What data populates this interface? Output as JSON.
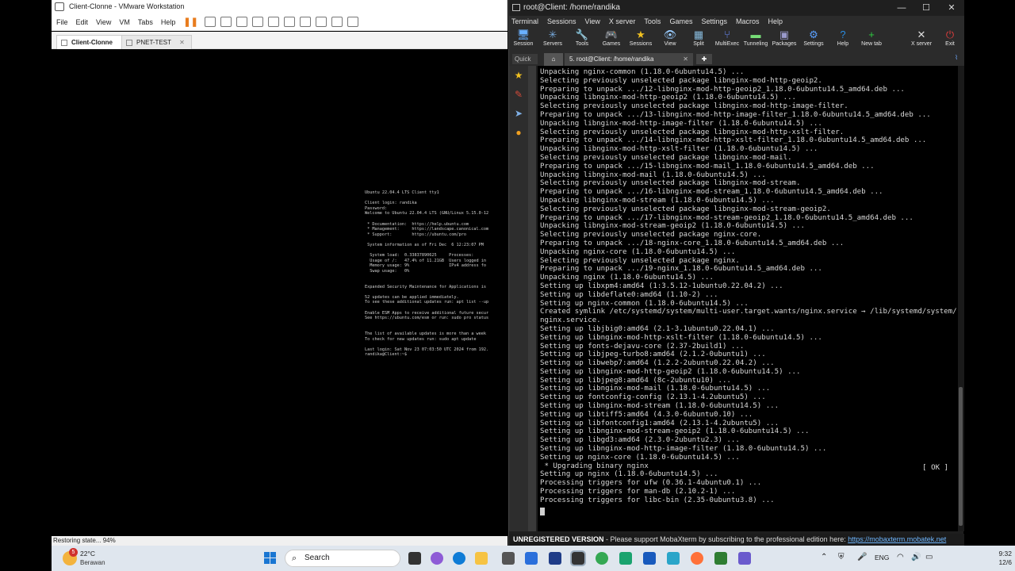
{
  "vmware": {
    "title": "Client-Clonne - VMware Workstation",
    "menu": [
      "File",
      "Edit",
      "View",
      "VM",
      "Tabs",
      "Help"
    ],
    "tabs": [
      {
        "label": "Client-Clonne",
        "active": true
      },
      {
        "label": "PNET-TEST",
        "active": false
      }
    ],
    "console_text": "Ubuntu 22.04.4 LTS Client tty1\n\nClient login: randika\nPassword:\nWelcome to Ubuntu 22.04.4 LTS (GNU/Linux 5.15.0-12\n\n * Documentation:  https://help.ubuntu.com\n * Management:     https://landscape.canonical.com\n * Support:        https://ubuntu.com/pro\n\n System information as of Fri Dec  6 12:23:07 PM\n\n  System load:  0.33837890625     Processes:\n  Usage of /:   47.4% of 11.21GB  Users logged in\n  Memory usage: 9%                IPv4 address fo\n  Swap usage:   0%\n\n\nExpanded Security Maintenance for Applications is\n\n52 updates can be applied immediately.\nTo see these additional updates run: apt list --up\n\nEnable ESM Apps to receive additional future secur\nSee https://ubuntu.com/esm or run: sudo pro status\n\n\nThe list of available updates is more than a week\nTo check for new updates run: sudo apt update\n\nLast login: Sat Nov 23 07:03:50 UTC 2024 from 192.\nrandika@Client:~$",
    "status": "Restoring state... 94%"
  },
  "moba": {
    "title": "root@Client: /home/randika",
    "menu": [
      "Terminal",
      "Sessions",
      "View",
      "X server",
      "Tools",
      "Games",
      "Settings",
      "Macros",
      "Help"
    ],
    "toolbar": [
      {
        "label": "Session",
        "icon": "session-icon",
        "glyph": "🖥"
      },
      {
        "label": "Servers",
        "icon": "servers-icon",
        "glyph": "✳"
      },
      {
        "label": "Tools",
        "icon": "tools-icon",
        "glyph": "🔧"
      },
      {
        "label": "Games",
        "icon": "games-icon",
        "glyph": "🎮"
      },
      {
        "label": "Sessions",
        "icon": "sessions-icon",
        "glyph": "★"
      },
      {
        "label": "View",
        "icon": "view-icon",
        "glyph": "👁"
      },
      {
        "label": "Split",
        "icon": "split-icon",
        "glyph": "▦"
      },
      {
        "label": "MultiExec",
        "icon": "multiexec-icon",
        "glyph": "⑂"
      },
      {
        "label": "Tunneling",
        "icon": "tunneling-icon",
        "glyph": "▬"
      },
      {
        "label": "Packages",
        "icon": "packages-icon",
        "glyph": "▣"
      },
      {
        "label": "Settings",
        "icon": "settings-icon",
        "glyph": "⚙"
      },
      {
        "label": "Help",
        "icon": "help-icon",
        "glyph": "?"
      },
      {
        "label": "New tab",
        "icon": "new-tab-icon",
        "glyph": "+"
      },
      {
        "label": "X server",
        "icon": "x-server-icon",
        "glyph": "✕"
      },
      {
        "label": "Exit",
        "icon": "exit-icon",
        "glyph": "⏻"
      }
    ],
    "quick_label": "Quick",
    "session_tab": "5. root@Client: /home/randika",
    "terminal_lines": [
      "Unpacking nginx-common (1.18.0-6ubuntu14.5) ...",
      "Selecting previously unselected package libnginx-mod-http-geoip2.",
      "Preparing to unpack .../12-libnginx-mod-http-geoip2_1.18.0-6ubuntu14.5_amd64.deb ...",
      "Unpacking libnginx-mod-http-geoip2 (1.18.0-6ubuntu14.5) ...",
      "Selecting previously unselected package libnginx-mod-http-image-filter.",
      "Preparing to unpack .../13-libnginx-mod-http-image-filter_1.18.0-6ubuntu14.5_amd64.deb ...",
      "Unpacking libnginx-mod-http-image-filter (1.18.0-6ubuntu14.5) ...",
      "Selecting previously unselected package libnginx-mod-http-xslt-filter.",
      "Preparing to unpack .../14-libnginx-mod-http-xslt-filter_1.18.0-6ubuntu14.5_amd64.deb ...",
      "Unpacking libnginx-mod-http-xslt-filter (1.18.0-6ubuntu14.5) ...",
      "Selecting previously unselected package libnginx-mod-mail.",
      "Preparing to unpack .../15-libnginx-mod-mail_1.18.0-6ubuntu14.5_amd64.deb ...",
      "Unpacking libnginx-mod-mail (1.18.0-6ubuntu14.5) ...",
      "Selecting previously unselected package libnginx-mod-stream.",
      "Preparing to unpack .../16-libnginx-mod-stream_1.18.0-6ubuntu14.5_amd64.deb ...",
      "Unpacking libnginx-mod-stream (1.18.0-6ubuntu14.5) ...",
      "Selecting previously unselected package libnginx-mod-stream-geoip2.",
      "Preparing to unpack .../17-libnginx-mod-stream-geoip2_1.18.0-6ubuntu14.5_amd64.deb ...",
      "Unpacking libnginx-mod-stream-geoip2 (1.18.0-6ubuntu14.5) ...",
      "Selecting previously unselected package nginx-core.",
      "Preparing to unpack .../18-nginx-core_1.18.0-6ubuntu14.5_amd64.deb ...",
      "Unpacking nginx-core (1.18.0-6ubuntu14.5) ...",
      "Selecting previously unselected package nginx.",
      "Preparing to unpack .../19-nginx_1.18.0-6ubuntu14.5_amd64.deb ...",
      "Unpacking nginx (1.18.0-6ubuntu14.5) ...",
      "Setting up libxpm4:amd64 (1:3.5.12-1ubuntu0.22.04.2) ...",
      "Setting up libdeflate0:amd64 (1.10-2) ...",
      "Setting up nginx-common (1.18.0-6ubuntu14.5) ...",
      "Created symlink /etc/systemd/system/multi-user.target.wants/nginx.service → /lib/systemd/system/",
      "nginx.service.",
      "Setting up libjbig0:amd64 (2.1-3.1ubuntu0.22.04.1) ...",
      "Setting up libnginx-mod-http-xslt-filter (1.18.0-6ubuntu14.5) ...",
      "Setting up fonts-dejavu-core (2.37-2build1) ...",
      "Setting up libjpeg-turbo8:amd64 (2.1.2-0ubuntu1) ...",
      "Setting up libwebp7:amd64 (1.2.2-2ubuntu0.22.04.2) ...",
      "Setting up libnginx-mod-http-geoip2 (1.18.0-6ubuntu14.5) ...",
      "Setting up libjpeg8:amd64 (8c-2ubuntu10) ...",
      "Setting up libnginx-mod-mail (1.18.0-6ubuntu14.5) ...",
      "Setting up fontconfig-config (2.13.1-4.2ubuntu5) ...",
      "Setting up libnginx-mod-stream (1.18.0-6ubuntu14.5) ...",
      "Setting up libtiff5:amd64 (4.3.0-6ubuntu0.10) ...",
      "Setting up libfontconfig1:amd64 (2.13.1-4.2ubuntu5) ...",
      "Setting up libnginx-mod-stream-geoip2 (1.18.0-6ubuntu14.5) ...",
      "Setting up libgd3:amd64 (2.3.0-2ubuntu2.3) ...",
      "Setting up libnginx-mod-http-image-filter (1.18.0-6ubuntu14.5) ...",
      "Setting up nginx-core (1.18.0-6ubuntu14.5) ...",
      " * Upgrading binary nginx",
      "Setting up nginx (1.18.0-6ubuntu14.5) ...",
      "Processing triggers for ufw (0.36.1-4ubuntu0.1) ...",
      "Processing triggers for man-db (2.10.2-1) ...",
      "Processing triggers for libc-bin (2.35-0ubuntu3.8) ..."
    ],
    "ok_text": "[ OK ]",
    "status_bold": "UNREGISTERED VERSION",
    "status_text": "  -  Please support MobaXterm by subscribing to the professional edition here: ",
    "status_link": "https://mobaxterm.mobatek.net"
  },
  "taskbar": {
    "weather_temp": "22°C",
    "weather_desc": "Berawan",
    "weather_badge": "5",
    "search_placeholder": "Search",
    "lang": "ENG",
    "time": "9:32",
    "date": "12/6"
  }
}
